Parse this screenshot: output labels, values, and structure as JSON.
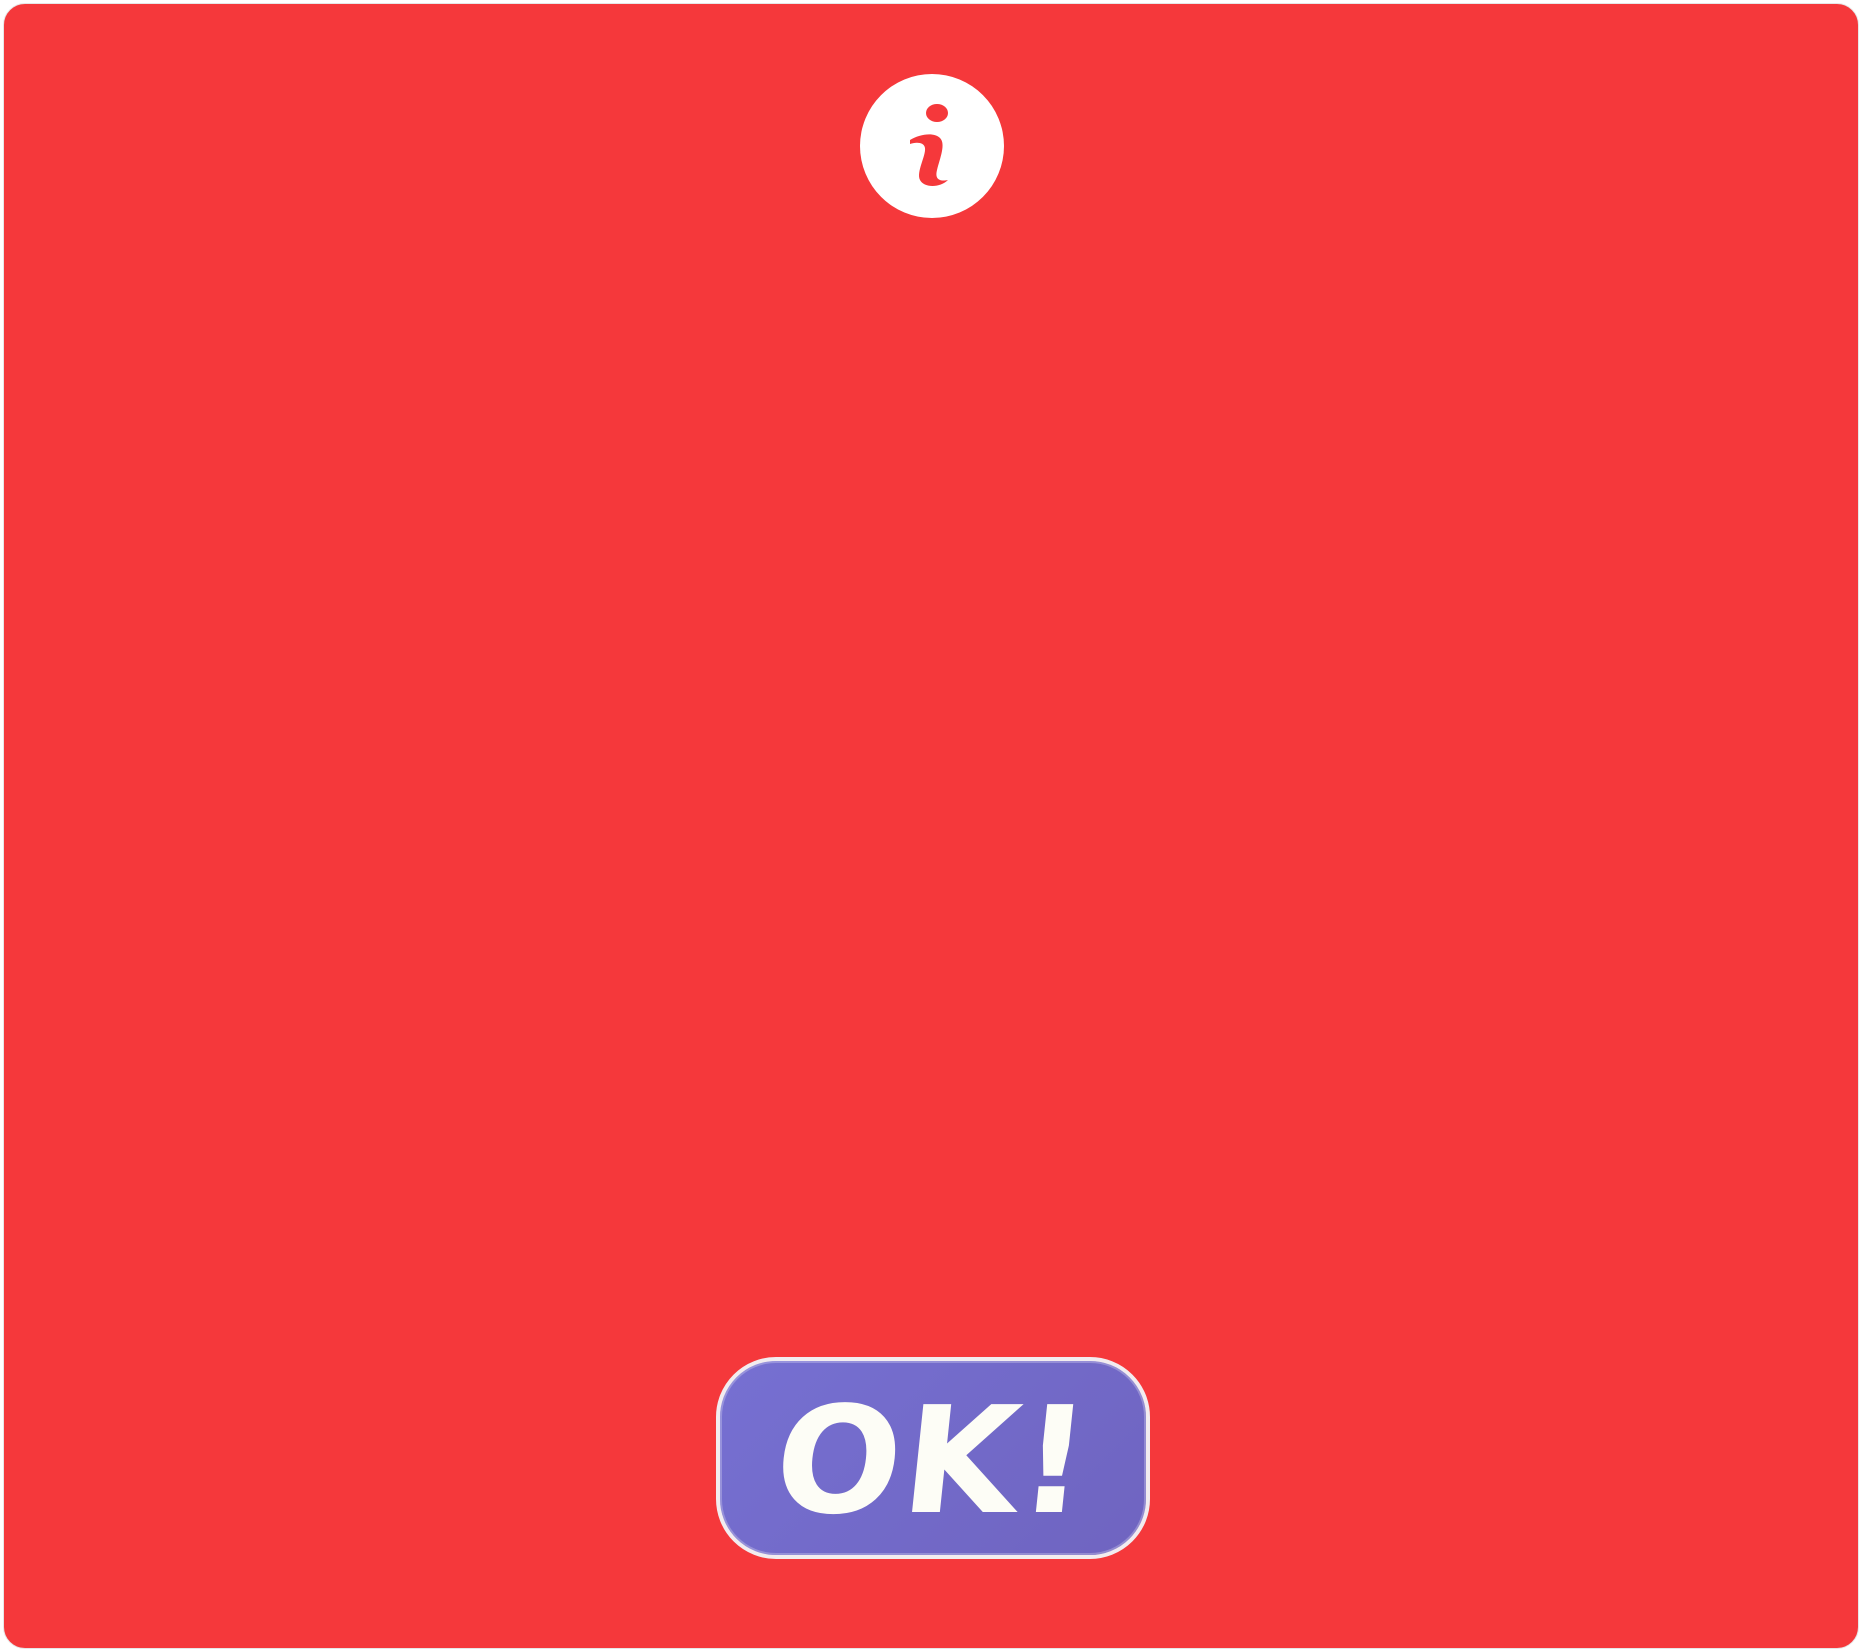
{
  "dialog": {
    "background_color": "#f5383b",
    "icon": "info-icon",
    "icon_color": "#ffffff",
    "button": {
      "label": "OK!",
      "color": "#7670d2",
      "text_color": "#fdfdf6"
    }
  }
}
